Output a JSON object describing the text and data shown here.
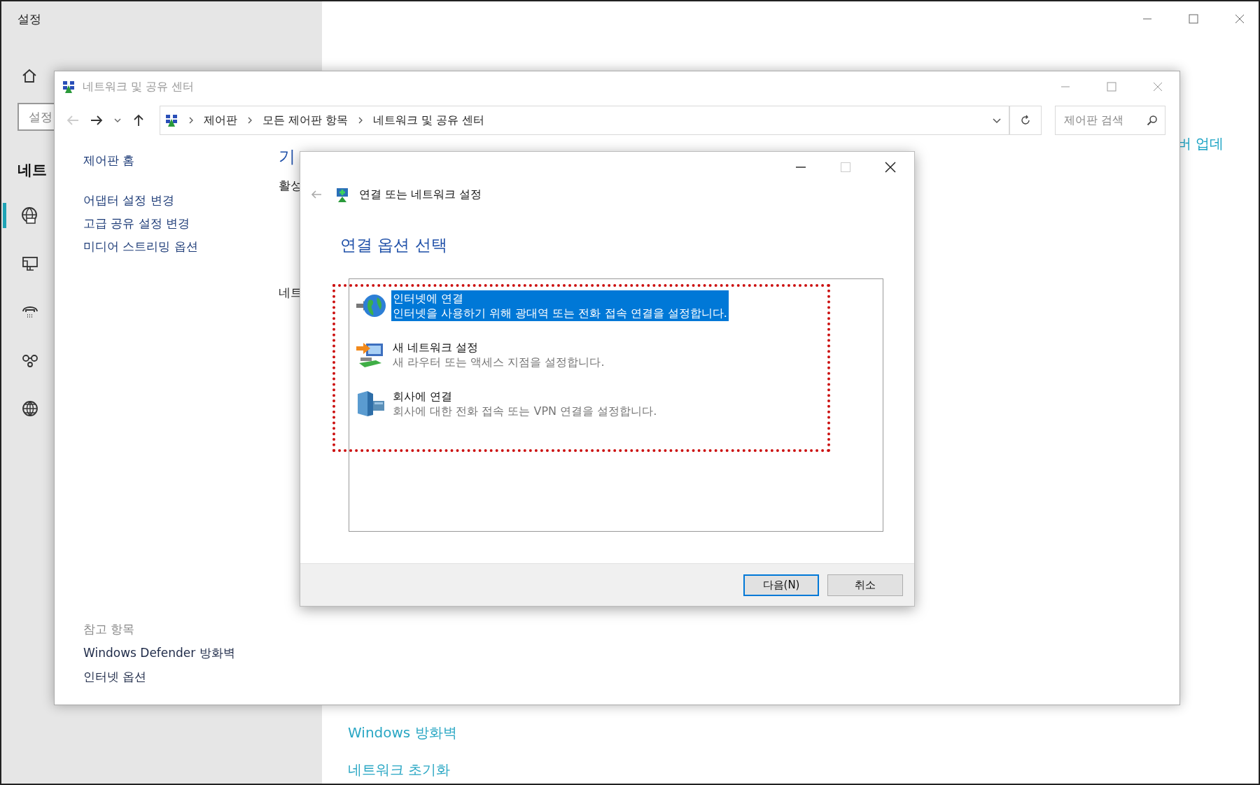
{
  "settings": {
    "title": "설정",
    "search": {
      "placeholder": "설정"
    },
    "section_heading": "네트",
    "nav_items": [
      {
        "selected": true
      },
      {
        "selected": false
      },
      {
        "selected": false
      },
      {
        "selected": false
      },
      {
        "selected": false
      }
    ],
    "top_link": "버 업데",
    "bottom_links": [
      "Windows 방화벽",
      "네트워크 초기화"
    ]
  },
  "control_panel": {
    "title": "네트워크 및 공유 센터",
    "back_enabled": false,
    "breadcrumb": [
      "제어판",
      "모든 제어판 항목",
      "네트워크 및 공유 센터"
    ],
    "search": {
      "placeholder": "제어판 검색"
    },
    "tasks": [
      "제어판 홈",
      "어댑터 설정 변경",
      "고급 공유 설정 변경",
      "미디어 스트리밍 옵션"
    ],
    "see_also": {
      "title": "참고 항목",
      "links": [
        "Windows Defender 방화벽",
        "인터넷 옵션"
      ]
    },
    "main": {
      "heading": "기",
      "labels": [
        "활성",
        "네트"
      ]
    }
  },
  "dialog": {
    "title": "연결 또는 네트워크 설정",
    "maximize_enabled": false,
    "heading": "연결 옵션 선택",
    "options": [
      {
        "title": "인터넷에 연결",
        "description": "인터넷을 사용하기 위해 광대역 또는 전화 접속 연결을 설정합니다.",
        "selected": true
      },
      {
        "title": "새 네트워크 설정",
        "description": "새 라우터 또는 액세스 지점을 설정합니다.",
        "selected": false
      },
      {
        "title": "회사에 연결",
        "description": "회사에 대한 전화 접속 또는 VPN 연결을 설정합니다.",
        "selected": false
      }
    ],
    "buttons": [
      {
        "label": "다음(N)",
        "default": true
      },
      {
        "label": "취소",
        "default": false
      }
    ]
  }
}
